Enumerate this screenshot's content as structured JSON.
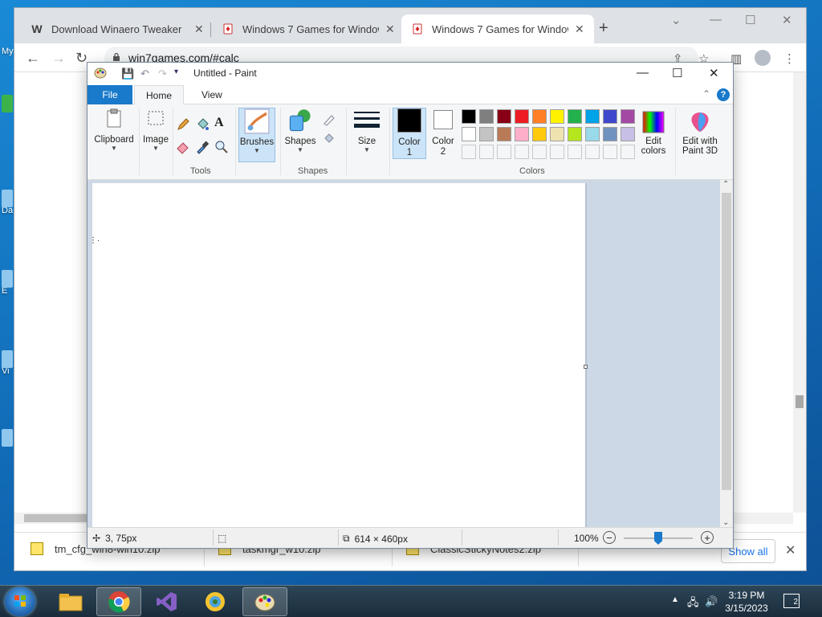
{
  "desktop": {
    "fragments": [
      "My",
      "Da",
      "E",
      "Vi"
    ]
  },
  "browser": {
    "tabs": [
      {
        "title": "Download Winaero Tweaker",
        "favicon": "W",
        "active": false
      },
      {
        "title": "Windows 7 Games for Windows",
        "favicon": "card-icon",
        "active": false
      },
      {
        "title": "Windows 7 Games for Windows",
        "favicon": "card-icon",
        "active": true
      }
    ],
    "new_tab": "+",
    "address": "win7games.com/#calc",
    "downloads": [
      {
        "name": "tm_cfg_win8-win10.zip"
      },
      {
        "name": "taskmgr_w10.zip"
      },
      {
        "name": "ClassicStickyNotes2.zip"
      }
    ],
    "show_all": "Show all"
  },
  "paint": {
    "title": "Untitled - Paint",
    "tabs": {
      "file": "File",
      "home": "Home",
      "view": "View"
    },
    "ribbon": {
      "clipboard": "Clipboard",
      "image": "Image",
      "tools_label": "Tools",
      "brushes": "Brushes",
      "shapes": "Shapes",
      "shapes_label": "Shapes",
      "size": "Size",
      "color1": [
        "Color",
        "1"
      ],
      "color2": [
        "Color",
        "2"
      ],
      "edit_colors": [
        "Edit",
        "colors"
      ],
      "colors_label": "Colors",
      "paint3d": [
        "Edit with",
        "Paint 3D"
      ]
    },
    "palette_row1": [
      "#000000",
      "#7f7f7f",
      "#880015",
      "#ed1c24",
      "#ff7f27",
      "#fff200",
      "#22b14c",
      "#00a2e8",
      "#3f48cc",
      "#a349a4"
    ],
    "palette_row2": [
      "#ffffff",
      "#c3c3c3",
      "#b97a57",
      "#ffaec9",
      "#ffc90e",
      "#efe4b0",
      "#b5e61d",
      "#99d9ea",
      "#7092be",
      "#c8bfe7"
    ],
    "palette_row3": [
      "#f5f6f7",
      "#f5f6f7",
      "#f5f6f7",
      "#f5f6f7",
      "#f5f6f7",
      "#f5f6f7",
      "#f5f6f7",
      "#f5f6f7",
      "#f5f6f7",
      "#f5f6f7"
    ],
    "color1_value": "#000000",
    "color2_value": "#ffffff",
    "status": {
      "cursor_pos": "3, 75px",
      "canvas_size": "614 × 460px",
      "zoom": "100%"
    }
  },
  "taskbar": {
    "time": "3:19 PM",
    "date": "3/15/2023"
  }
}
